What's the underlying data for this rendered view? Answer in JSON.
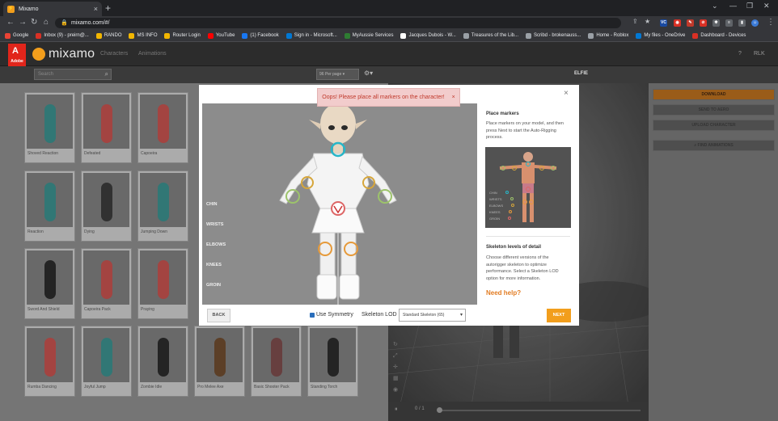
{
  "browser": {
    "tab_title": "Mixamo",
    "url": "mixamo.com/#/",
    "bookmarks": [
      {
        "label": "Google",
        "color": "#ea4335"
      },
      {
        "label": "Inbox (9) - preirn@...",
        "color": "#d93025"
      },
      {
        "label": "RANDO",
        "color": "#f2b600"
      },
      {
        "label": "MS INFO",
        "color": "#f2b600"
      },
      {
        "label": "Router Login",
        "color": "#f2b600"
      },
      {
        "label": "YouTube",
        "color": "#ff0000"
      },
      {
        "label": "(1) Facebook",
        "color": "#1877f2"
      },
      {
        "label": "Sign in - Microsoft...",
        "color": "#0078d4"
      },
      {
        "label": "MyAussie Services",
        "color": "#2e7d32"
      },
      {
        "label": "Jacques Dubois - W...",
        "color": "#ffffff"
      },
      {
        "label": "Treasures of the Lib...",
        "color": "#9aa0a6"
      },
      {
        "label": "Scribd - brokenauss...",
        "color": "#9aa0a6"
      },
      {
        "label": "Home - Roblox",
        "color": "#9aa0a6"
      },
      {
        "label": "My files - OneDrive",
        "color": "#0078d4"
      },
      {
        "label": "Dashboard - Devices",
        "color": "#d93025"
      }
    ]
  },
  "header": {
    "adobe": "Adobe",
    "title": "mixamo",
    "nav": [
      "Characters",
      "Animations"
    ],
    "user": "RLK"
  },
  "toolbar": {
    "search_placeholder": "Search",
    "per_page": "96 Per page",
    "character_name": "ELFIE"
  },
  "cards": [
    {
      "label": "Shoved Reaction",
      "color": "#3a8c8a"
    },
    {
      "label": "Defeated",
      "color": "#c0504d"
    },
    {
      "label": "Capoeira",
      "color": "#c0504d"
    },
    {
      "label": "Reaction",
      "color": "#3a8c8a"
    },
    {
      "label": "Dying",
      "color": "#3a3a3a"
    },
    {
      "label": "Jumping Down",
      "color": "#3a8c8a"
    },
    {
      "label": "Sword And Shield",
      "color": "#2b2b2b"
    },
    {
      "label": "Capoeira Pack",
      "color": "#c0504d"
    },
    {
      "label": "Praying",
      "color": "#c0504d"
    },
    {
      "label": "Rumba Dancing",
      "color": "#c0504d"
    },
    {
      "label": "Joyful Jump",
      "color": "#3a8c8a"
    },
    {
      "label": "Zombie Idle",
      "color": "#2b2b2b"
    },
    {
      "label": "Pro Melee Axe",
      "color": "#6d4a2e"
    },
    {
      "label": "Basic Shooter Pack",
      "color": "#7a4a4a"
    },
    {
      "label": "Standing Torch",
      "color": "#2b2b2b"
    }
  ],
  "right_panel": {
    "download": "DOWNLOAD",
    "send_to_aero": "SEND TO AERO",
    "upload": "UPLOAD CHARACTER",
    "find": "FIND ANIMATIONS"
  },
  "viewport": {
    "frame": "0 / 1"
  },
  "modal": {
    "toast": "Oops! Please place all markers on the character!",
    "marker_labels": [
      "CHIN",
      "WRISTS",
      "ELBOWS",
      "KNEES",
      "GROIN"
    ],
    "place_title": "Place markers",
    "place_text": "Place markers on your model, and then press Next to start the Auto-Rigging process.",
    "preview_labels": [
      "CHIN",
      "WRISTS",
      "ELBOWS",
      "KNEES",
      "GROIN"
    ],
    "lod_title": "Skeleton levels of detail",
    "lod_text": "Choose different versions of the autorigger skeleton to optimize performance. Select a Skeleton LOD option for more information.",
    "need_help": "Need help?",
    "back": "BACK",
    "use_symmetry": "Use Symmetry",
    "lod_label": "Skeleton LOD",
    "lod_value": "Standard Skeleton (65)",
    "next": "NEXT"
  }
}
